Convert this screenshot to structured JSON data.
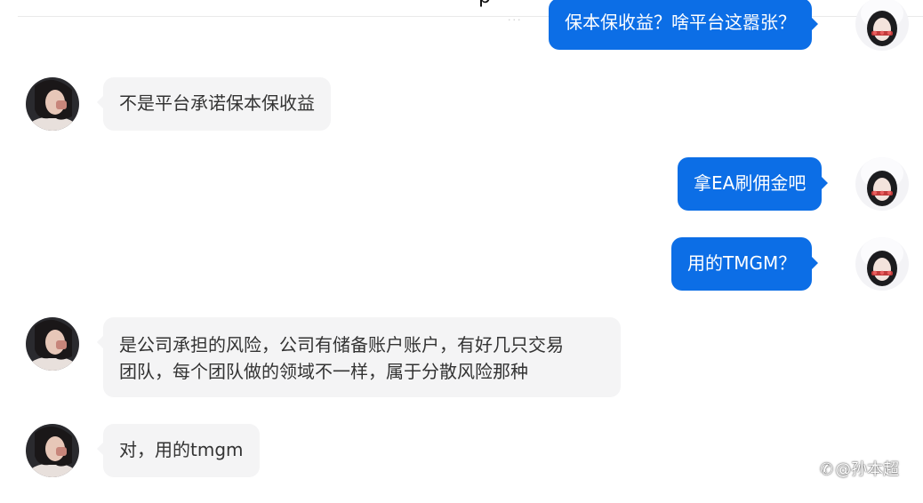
{
  "conversation": {
    "header_glyph": "p",
    "messages": [
      {
        "side": "right",
        "text": "保本保收益？啥平台这嚣张？"
      },
      {
        "side": "left",
        "text": "不是平台承诺保本保收益"
      },
      {
        "side": "right",
        "text": "拿EA刷佣金吧"
      },
      {
        "side": "right",
        "text": "用的TMGM？"
      },
      {
        "side": "left",
        "lines": [
          "是公司承担的风险，公司有储备账户账户，有好几只交易",
          "团队，每个团队做的领域不一样，属于分散风险那种"
        ]
      },
      {
        "side": "left",
        "text": "对，用的tmgm"
      }
    ]
  },
  "watermark": {
    "text": "@孙本超"
  },
  "colors": {
    "outgoing_bubble": "#0c6ee6",
    "incoming_bubble": "#f4f4f5"
  }
}
